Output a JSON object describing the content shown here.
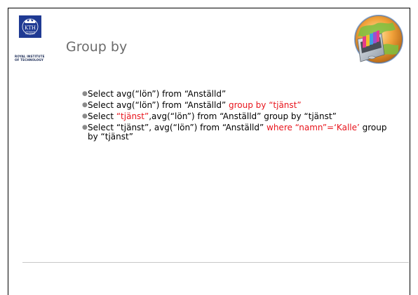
{
  "slide": {
    "title": "Group by"
  },
  "logo": {
    "mark_text": "KTH",
    "mark_sub_1": "VETENSKAP",
    "mark_sub_2": "OCH KONST",
    "caption_line1": "ROYAL INSTITUTE",
    "caption_line2": "OF TECHNOLOGY",
    "icon": "kth-logo-icon"
  },
  "illustration": {
    "icon": "globe-file-cabinet-icon"
  },
  "bullets": [
    {
      "part1": "Select avg(“lön”) from “Anställd”"
    },
    {
      "part1": "Select avg(“lön”) from “Anställd” ",
      "part2": "group by “tjänst”"
    },
    {
      "part1": "Select ",
      "part2": "“tjänst”",
      "part3": ",avg(“lön”) from “Anställd” group by “tjänst”"
    },
    {
      "part1": "Select “tjänst”, avg(“lön”) from “Anställd” ",
      "part2": "where “namn”=‘Kalle’",
      "part3": " group by “tjänst”"
    }
  ],
  "colors": {
    "title": "#6b6b6b",
    "highlight": "#e8141c",
    "kth_blue": "#1f3a93",
    "rule": "#c8c8c8"
  }
}
